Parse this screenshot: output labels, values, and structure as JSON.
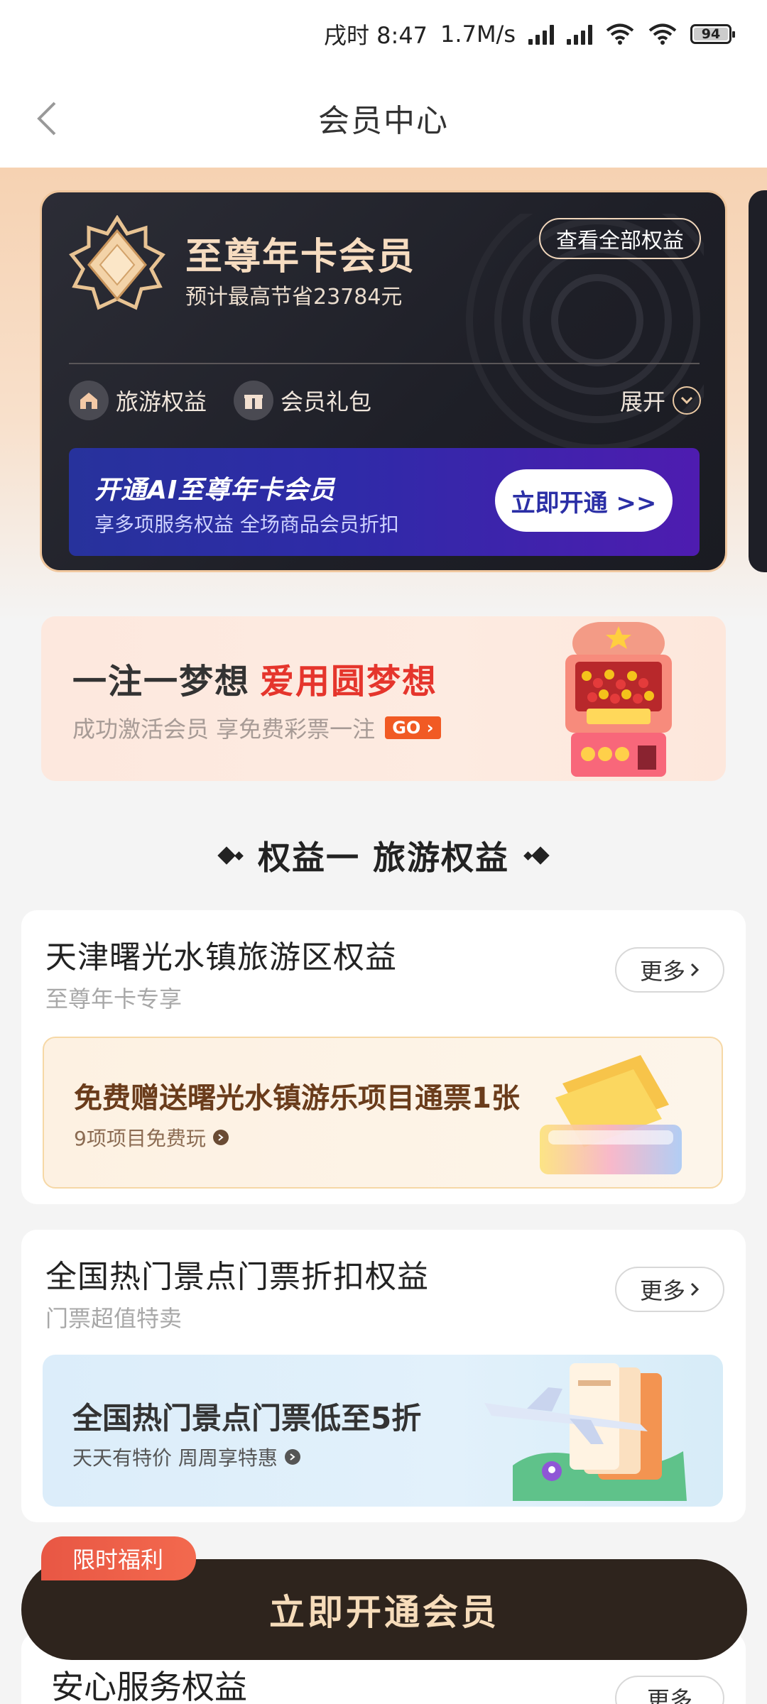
{
  "status_bar": {
    "time": "戌时 8:47",
    "speed": "1.7M/s",
    "battery": "94"
  },
  "nav": {
    "title": "会员中心"
  },
  "member_card": {
    "title": "至尊年卡会员",
    "subtitle": "预计最高节省23784元",
    "all_benefits": "查看全部权益",
    "tags": [
      "旅游权益",
      "会员礼包"
    ],
    "expand": "展开",
    "open_banner": {
      "title": "开通AI至尊年卡会员",
      "subtitle": "享多项服务权益 全场商品会员折扣",
      "button": "立即开通 >>"
    }
  },
  "lottery": {
    "title_main": "一注一梦想",
    "title_highlight": "爱用圆梦想",
    "subtitle": "成功激活会员 享免费彩票一注",
    "go": "GO"
  },
  "section": {
    "title": "权益一 旅游权益"
  },
  "benefit_1": {
    "title": "天津曙光水镇旅游区权益",
    "subtitle": "至尊年卡专享",
    "more": "更多",
    "promo_title": "免费赠送曙光水镇游乐项目通票1张",
    "promo_sub": "9项项目免费玩"
  },
  "benefit_2": {
    "title": "全国热门景点门票折扣权益",
    "subtitle": "门票超值特卖",
    "more": "更多",
    "promo_title": "全国热门景点门票低至5折",
    "promo_sub": "天天有特价 周周享特惠"
  },
  "benefit_3": {
    "title": "安心服务权益",
    "more": "更多"
  },
  "cta": {
    "label": "立即开通会员",
    "limited_tag": "限时福利"
  },
  "colors": {
    "card_bg": "#1e1f27",
    "gold": "#f6dcc0",
    "accent_red": "#e5352c",
    "cta_bg": "#2e241d"
  }
}
